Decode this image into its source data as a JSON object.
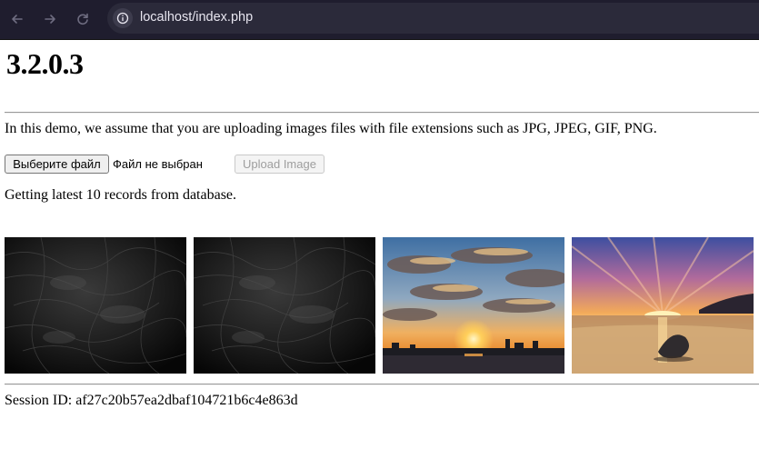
{
  "browser": {
    "url": "localhost/index.php",
    "icons": [
      "back-arrow-icon",
      "forward-arrow-icon",
      "reload-icon",
      "site-info-icon"
    ]
  },
  "page": {
    "title": "3.2.0.3",
    "intro": "In this demo, we assume that you are uploading images files with file extensions such as JPG, JPEG, GIF, PNG.",
    "file_button": "Выберите файл",
    "file_status": "Файл не выбран",
    "upload_button": "Upload Image",
    "records_text": "Getting latest 10 records from database.",
    "gallery": [
      {
        "name": "dark-texture-1"
      },
      {
        "name": "dark-texture-2"
      },
      {
        "name": "sunset-city"
      },
      {
        "name": "sunset-beach"
      }
    ],
    "session": "Session ID: af27c20b57ea2dbaf104721b6c4e863d"
  }
}
